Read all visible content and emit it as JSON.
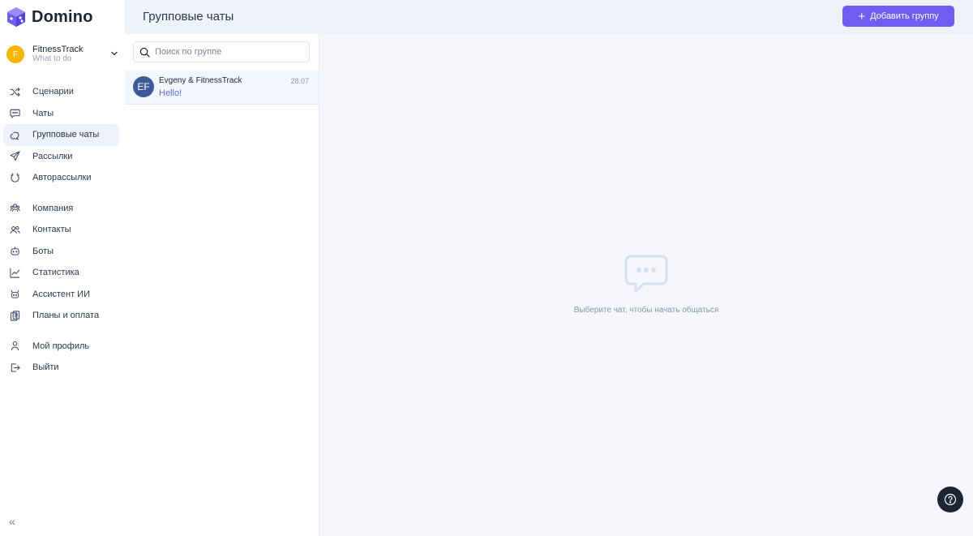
{
  "app": {
    "logo_text": "Domino"
  },
  "account": {
    "initial": "F",
    "name": "FitnessTrack",
    "subtitle": "What to do"
  },
  "nav": {
    "group1": [
      {
        "label": "Сценарии",
        "icon": "shuffle-icon"
      },
      {
        "label": "Чаты",
        "icon": "chat-icon"
      },
      {
        "label": "Групповые чаты",
        "icon": "group-chat-icon",
        "active": true
      },
      {
        "label": "Рассылки",
        "icon": "send-icon"
      },
      {
        "label": "Авторассылки",
        "icon": "auto-send-icon"
      }
    ],
    "group2": [
      {
        "label": "Компания",
        "icon": "company-icon"
      },
      {
        "label": "Контакты",
        "icon": "contacts-icon"
      },
      {
        "label": "Боты",
        "icon": "bot-icon"
      },
      {
        "label": "Статистика",
        "icon": "chart-icon"
      },
      {
        "label": "Ассистент ИИ",
        "icon": "ai-assistant-icon"
      },
      {
        "label": "Планы и оплата",
        "icon": "billing-icon"
      }
    ],
    "group3": [
      {
        "label": "Мой профиль",
        "icon": "user-icon"
      },
      {
        "label": "Выйти",
        "icon": "logout-icon"
      }
    ],
    "collapse_glyph": "«"
  },
  "header": {
    "title": "Групповые чаты",
    "add_button_label": "Добавить группу"
  },
  "search": {
    "placeholder": "Поиск по группе",
    "value": ""
  },
  "chats": [
    {
      "initials": "EF",
      "name": "Evgeny & FitnessTrack",
      "time": "28.07",
      "last_message": "Hello!"
    }
  ],
  "empty_state": {
    "text": "Выберите чат, чтобы начать общаться"
  },
  "colors": {
    "accent": "#6f5cf1",
    "avatar_account": "#f7b500",
    "avatar_chat": "#3d5a99",
    "help_button": "#1d2433"
  }
}
